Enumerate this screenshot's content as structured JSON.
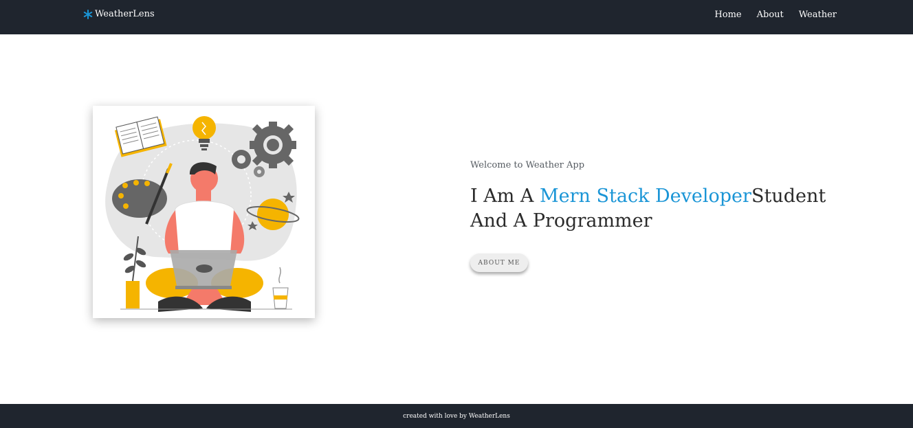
{
  "navbar": {
    "brand": "WeatherLens",
    "brand_icon": "snowflake-icon",
    "links": [
      "Home",
      "About",
      "Weather"
    ]
  },
  "hero": {
    "welcome": "Welcome to Weather App",
    "headline_prefix": "I Am A ",
    "headline_accent": "Mern Stack Developer",
    "headline_suffix": "Student And A Programmer",
    "button": "ABOUT ME"
  },
  "footer": {
    "text": "created with love by WeatherLens"
  },
  "colors": {
    "navbar": "#1f252e",
    "accent": "#1a95d6",
    "illustration_yellow": "#f5b400",
    "illustration_coral": "#f47a6a"
  }
}
